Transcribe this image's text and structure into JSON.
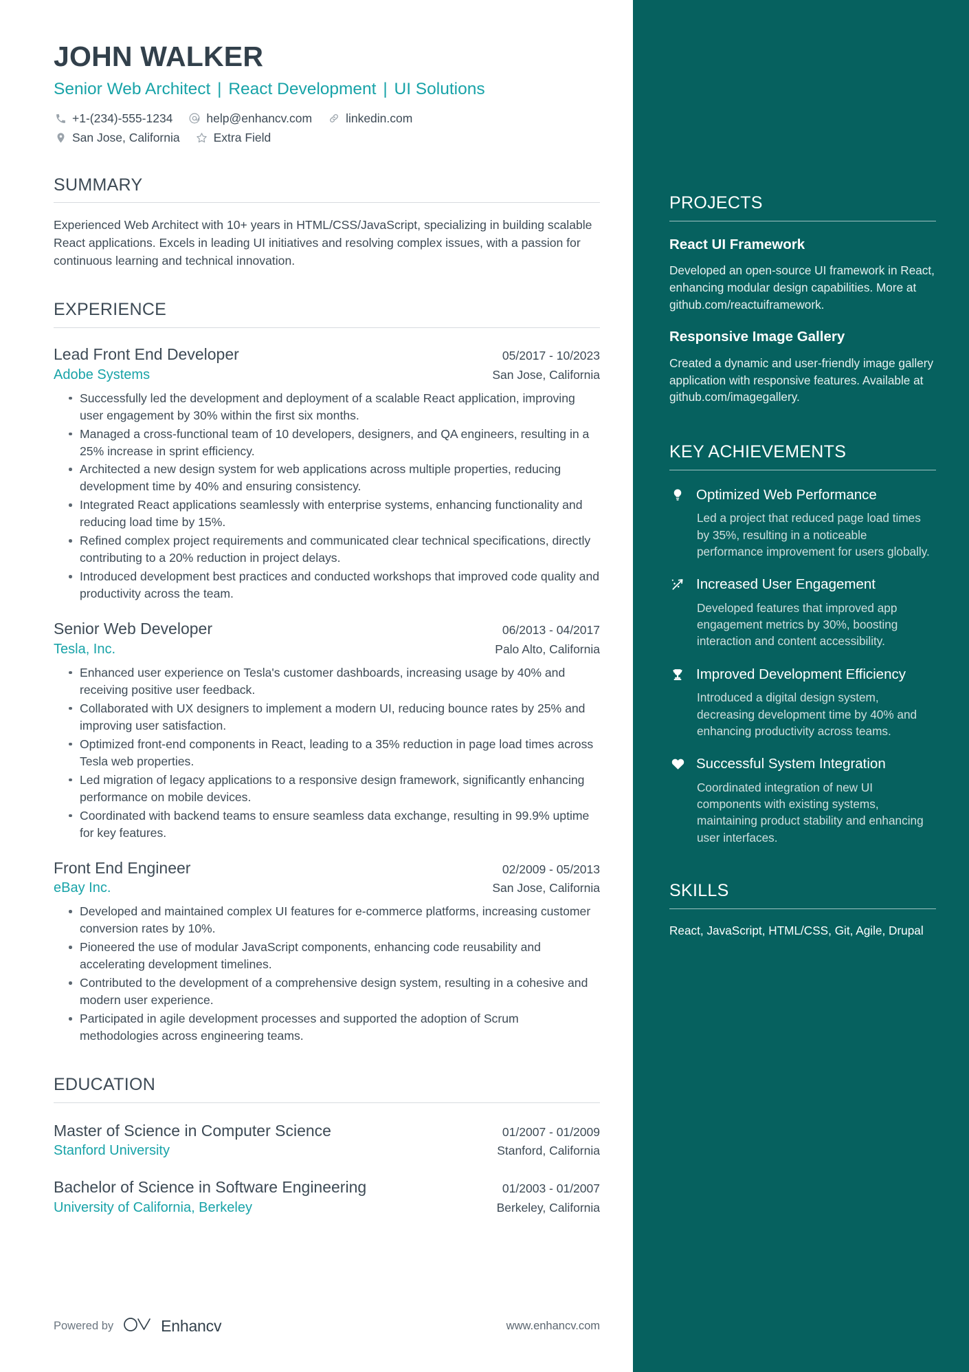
{
  "header": {
    "name": "JOHN WALKER",
    "headline_parts": [
      "Senior Web Architect",
      "React Development",
      "UI Solutions"
    ],
    "headline_separator": "|",
    "contacts": [
      {
        "icon": "phone-icon",
        "text": "+1-(234)-555-1234"
      },
      {
        "icon": "email-icon",
        "text": "help@enhancv.com"
      },
      {
        "icon": "link-icon",
        "text": "linkedin.com"
      },
      {
        "icon": "location-pin-icon",
        "text": "San Jose, California"
      },
      {
        "icon": "star-icon",
        "text": "Extra Field"
      }
    ]
  },
  "summary": {
    "title": "SUMMARY",
    "text": "Experienced Web Architect with 10+ years in HTML/CSS/JavaScript, specializing in building scalable React applications. Excels in leading UI initiatives and resolving complex issues, with a passion for continuous learning and technical innovation."
  },
  "experience": {
    "title": "EXPERIENCE",
    "entries": [
      {
        "role": "Lead Front End Developer",
        "date": "05/2017 - 10/2023",
        "company": "Adobe Systems",
        "location": "San Jose, California",
        "bullets": [
          "Successfully led the development and deployment of a scalable React application, improving user engagement by 30% within the first six months.",
          "Managed a cross-functional team of 10 developers, designers, and QA engineers, resulting in a 25% increase in sprint efficiency.",
          "Architected a new design system for web applications across multiple properties, reducing development time by 40% and ensuring consistency.",
          "Integrated React applications seamlessly with enterprise systems, enhancing functionality and reducing load time by 15%.",
          "Refined complex project requirements and communicated clear technical specifications, directly contributing to a 20% reduction in project delays.",
          "Introduced development best practices and conducted workshops that improved code quality and productivity across the team."
        ]
      },
      {
        "role": "Senior Web Developer",
        "date": "06/2013 - 04/2017",
        "company": "Tesla, Inc.",
        "location": "Palo Alto, California",
        "bullets": [
          "Enhanced user experience on Tesla's customer dashboards, increasing usage by 40% and receiving positive user feedback.",
          "Collaborated with UX designers to implement a modern UI, reducing bounce rates by 25% and improving user satisfaction.",
          "Optimized front-end components in React, leading to a 35% reduction in page load times across Tesla web properties.",
          "Led migration of legacy applications to a responsive design framework, significantly enhancing performance on mobile devices.",
          "Coordinated with backend teams to ensure seamless data exchange, resulting in 99.9% uptime for key features."
        ]
      },
      {
        "role": "Front End Engineer",
        "date": "02/2009 - 05/2013",
        "company": "eBay Inc.",
        "location": "San Jose, California",
        "bullets": [
          "Developed and maintained complex UI features for e-commerce platforms, increasing customer conversion rates by 10%.",
          "Pioneered the use of modular JavaScript components, enhancing code reusability and accelerating development timelines.",
          "Contributed to the development of a comprehensive design system, resulting in a cohesive and modern user experience.",
          "Participated in agile development processes and supported the adoption of Scrum methodologies across engineering teams."
        ]
      }
    ]
  },
  "education": {
    "title": "EDUCATION",
    "entries": [
      {
        "degree": "Master of Science in Computer Science",
        "date": "01/2007 - 01/2009",
        "school": "Stanford University",
        "location": "Stanford, California"
      },
      {
        "degree": "Bachelor of Science in Software Engineering",
        "date": "01/2003 - 01/2007",
        "school": "University of California, Berkeley",
        "location": "Berkeley, California"
      }
    ]
  },
  "footer": {
    "powered_by": "Powered by",
    "brand": "Enhancv",
    "url": "www.enhancv.com"
  },
  "sidebar": {
    "projects": {
      "title": "PROJECTS",
      "items": [
        {
          "name": "React UI Framework",
          "description": "Developed an open-source UI framework in React, enhancing modular design capabilities. More at github.com/reactuiframework."
        },
        {
          "name": "Responsive Image Gallery",
          "description": "Created a dynamic and user-friendly image gallery application with responsive features. Available at github.com/imagegallery."
        }
      ]
    },
    "achievements": {
      "title": "KEY ACHIEVEMENTS",
      "items": [
        {
          "icon": "lightbulb-icon",
          "title": "Optimized Web Performance",
          "description": "Led a project that reduced page load times by 35%, resulting in a noticeable performance improvement for users globally."
        },
        {
          "icon": "rocket-growth-icon",
          "title": "Increased User Engagement",
          "description": "Developed features that improved app engagement metrics by 30%, boosting interaction and content accessibility."
        },
        {
          "icon": "trophy-icon",
          "title": "Improved Development Efficiency",
          "description": "Introduced a digital design system, decreasing development time by 40% and enhancing productivity across teams."
        },
        {
          "icon": "heart-icon",
          "title": "Successful System Integration",
          "description": "Coordinated integration of new UI components with existing systems, maintaining product stability and enhancing user interfaces."
        }
      ]
    },
    "skills": {
      "title": "SKILLS",
      "text": "React, JavaScript, HTML/CSS, Git, Agile, Drupal"
    }
  },
  "colors": {
    "sidebar_bg": "#06615F",
    "accent_teal": "#18A3A8",
    "text_dark": "#3D4A55"
  }
}
